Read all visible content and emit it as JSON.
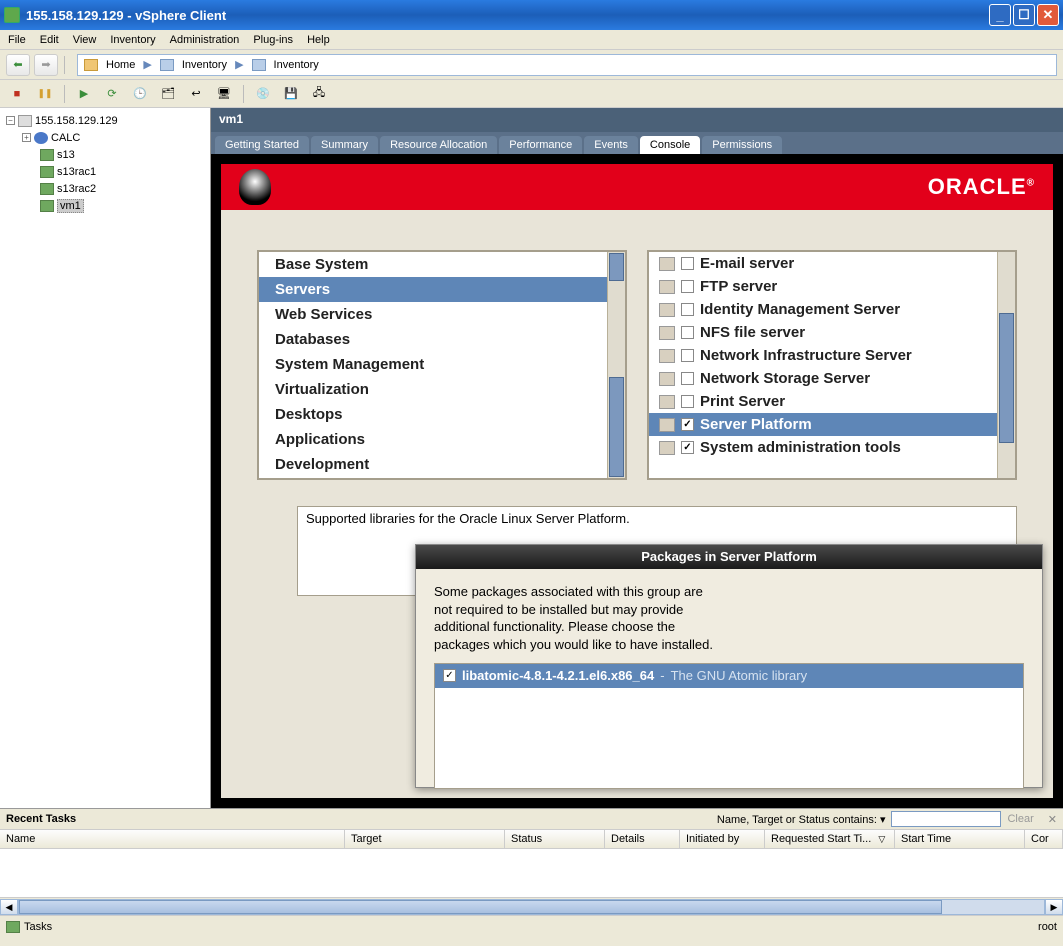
{
  "window": {
    "title": "155.158.129.129 - vSphere Client"
  },
  "menu": {
    "items": [
      "File",
      "Edit",
      "View",
      "Inventory",
      "Administration",
      "Plug-ins",
      "Help"
    ]
  },
  "breadcrumb": {
    "home": "Home",
    "inv1": "Inventory",
    "inv2": "Inventory"
  },
  "tree": {
    "host": "155.158.129.129",
    "calc": "CALC",
    "s13": "s13",
    "s13rac1": "s13rac1",
    "s13rac2": "s13rac2",
    "vm1": "vm1"
  },
  "vm": {
    "name": "vm1"
  },
  "tabs": {
    "getting_started": "Getting Started",
    "summary": "Summary",
    "resource": "Resource Allocation",
    "performance": "Performance",
    "events": "Events",
    "console": "Console",
    "permissions": "Permissions"
  },
  "oracle": {
    "logo": "ORACLE"
  },
  "categories": {
    "items": [
      "Base System",
      "Servers",
      "Web Services",
      "Databases",
      "System Management",
      "Virtualization",
      "Desktops",
      "Applications",
      "Development"
    ],
    "selected_index": 1
  },
  "packages": {
    "items": [
      {
        "label": "E-mail server",
        "checked": false
      },
      {
        "label": "FTP server",
        "checked": false
      },
      {
        "label": "Identity Management Server",
        "checked": false
      },
      {
        "label": "NFS file server",
        "checked": false
      },
      {
        "label": "Network Infrastructure Server",
        "checked": false
      },
      {
        "label": "Network Storage Server",
        "checked": false
      },
      {
        "label": "Print Server",
        "checked": false
      },
      {
        "label": "Server Platform",
        "checked": true
      },
      {
        "label": "System administration tools",
        "checked": true
      }
    ],
    "selected_index": 7
  },
  "desc": {
    "text": "Supported libraries for the Oracle Linux Server Platform."
  },
  "dialog": {
    "title": "Packages in Server Platform",
    "body1": "Some packages associated with this group are",
    "body2": "not required to be installed but may provide",
    "body3": "additional functionality.  Please choose the",
    "body4": "packages which you would like to have installed.",
    "pkg": {
      "name": "libatomic-4.8.1-4.2.1.el6.x86_64",
      "sep": " - ",
      "desc": "The GNU Atomic library",
      "checked": true
    }
  },
  "recent_tasks": {
    "header": "Recent Tasks",
    "filter_label": "Name, Target or Status contains: ▾",
    "clear": "Clear",
    "close_glyph": "✕",
    "columns": {
      "name": "Name",
      "target": "Target",
      "status": "Status",
      "details": "Details",
      "initiated": "Initiated by",
      "req_start": "Requested Start Ti...",
      "start": "Start Time",
      "completed": "Cor"
    }
  },
  "statusbar": {
    "tasks": "Tasks",
    "user": "root"
  },
  "glyphs": {
    "back": "⬅",
    "fwd": "➡",
    "minus": "−",
    "plus": "+",
    "stop": "■",
    "pause": "❚❚",
    "play": "▶",
    "check": "✓",
    "left": "◀",
    "right": "▶",
    "sortdesc": "▽"
  },
  "colors": {
    "accent": "#2A7BE0",
    "oracle_red": "#E2001A",
    "select_blue": "#5E86B7"
  }
}
